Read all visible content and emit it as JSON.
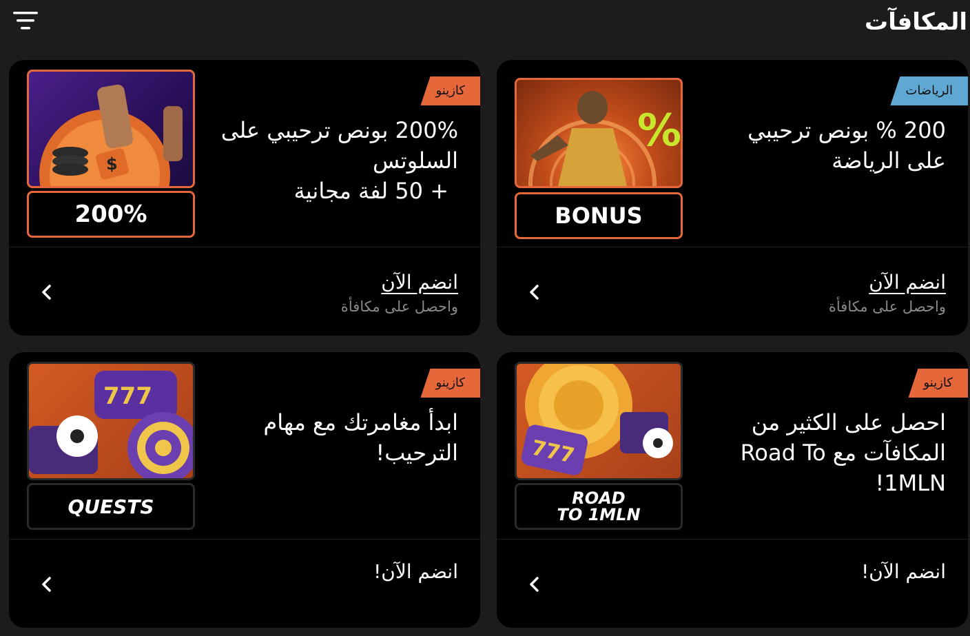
{
  "header": {
    "title": "المكافآت",
    "filter_icon": "filter-lines-icon"
  },
  "cards": [
    {
      "badge": "الرياضات",
      "badge_color": "#5fa8d3",
      "title_lines": [
        "200 % بونص ترحيبي",
        "على الرياضة"
      ],
      "thumb_label": "BONUS",
      "cta": "انضم الآن",
      "subtext": "واحصل على مكافأة"
    },
    {
      "badge": "كازينو",
      "badge_color": "#e6673a",
      "title_lines": [
        "200% بونص ترحيبي على",
        "السلوتس",
        "+ 50 لفة مجانية"
      ],
      "thumb_label": "200%",
      "cta": "انضم الآن",
      "subtext": "واحصل على مكافأة"
    },
    {
      "badge": "كازينو",
      "badge_color": "#e6673a",
      "title_lines": [
        "احصل على الكثير من",
        "المكافآت مع Road To",
        "1MLN!"
      ],
      "thumb_label_lines": [
        "ROAD",
        "TO 1MLN"
      ],
      "cta": "انضم الآن!"
    },
    {
      "badge": "كازينو",
      "badge_color": "#e6673a",
      "title_lines": [
        "ابدأ مغامرتك مع مهام",
        "الترحيب!"
      ],
      "thumb_label": "QUESTS",
      "cta": "انضم الآن!"
    }
  ],
  "colors": {
    "accent": "#e6673a",
    "sports_badge": "#5fa8d3",
    "card_bg": "#000000",
    "page_bg": "#1c1c1c",
    "muted_text": "#8a8a8a"
  },
  "icons": {
    "chevron": "chevron-left-icon"
  }
}
